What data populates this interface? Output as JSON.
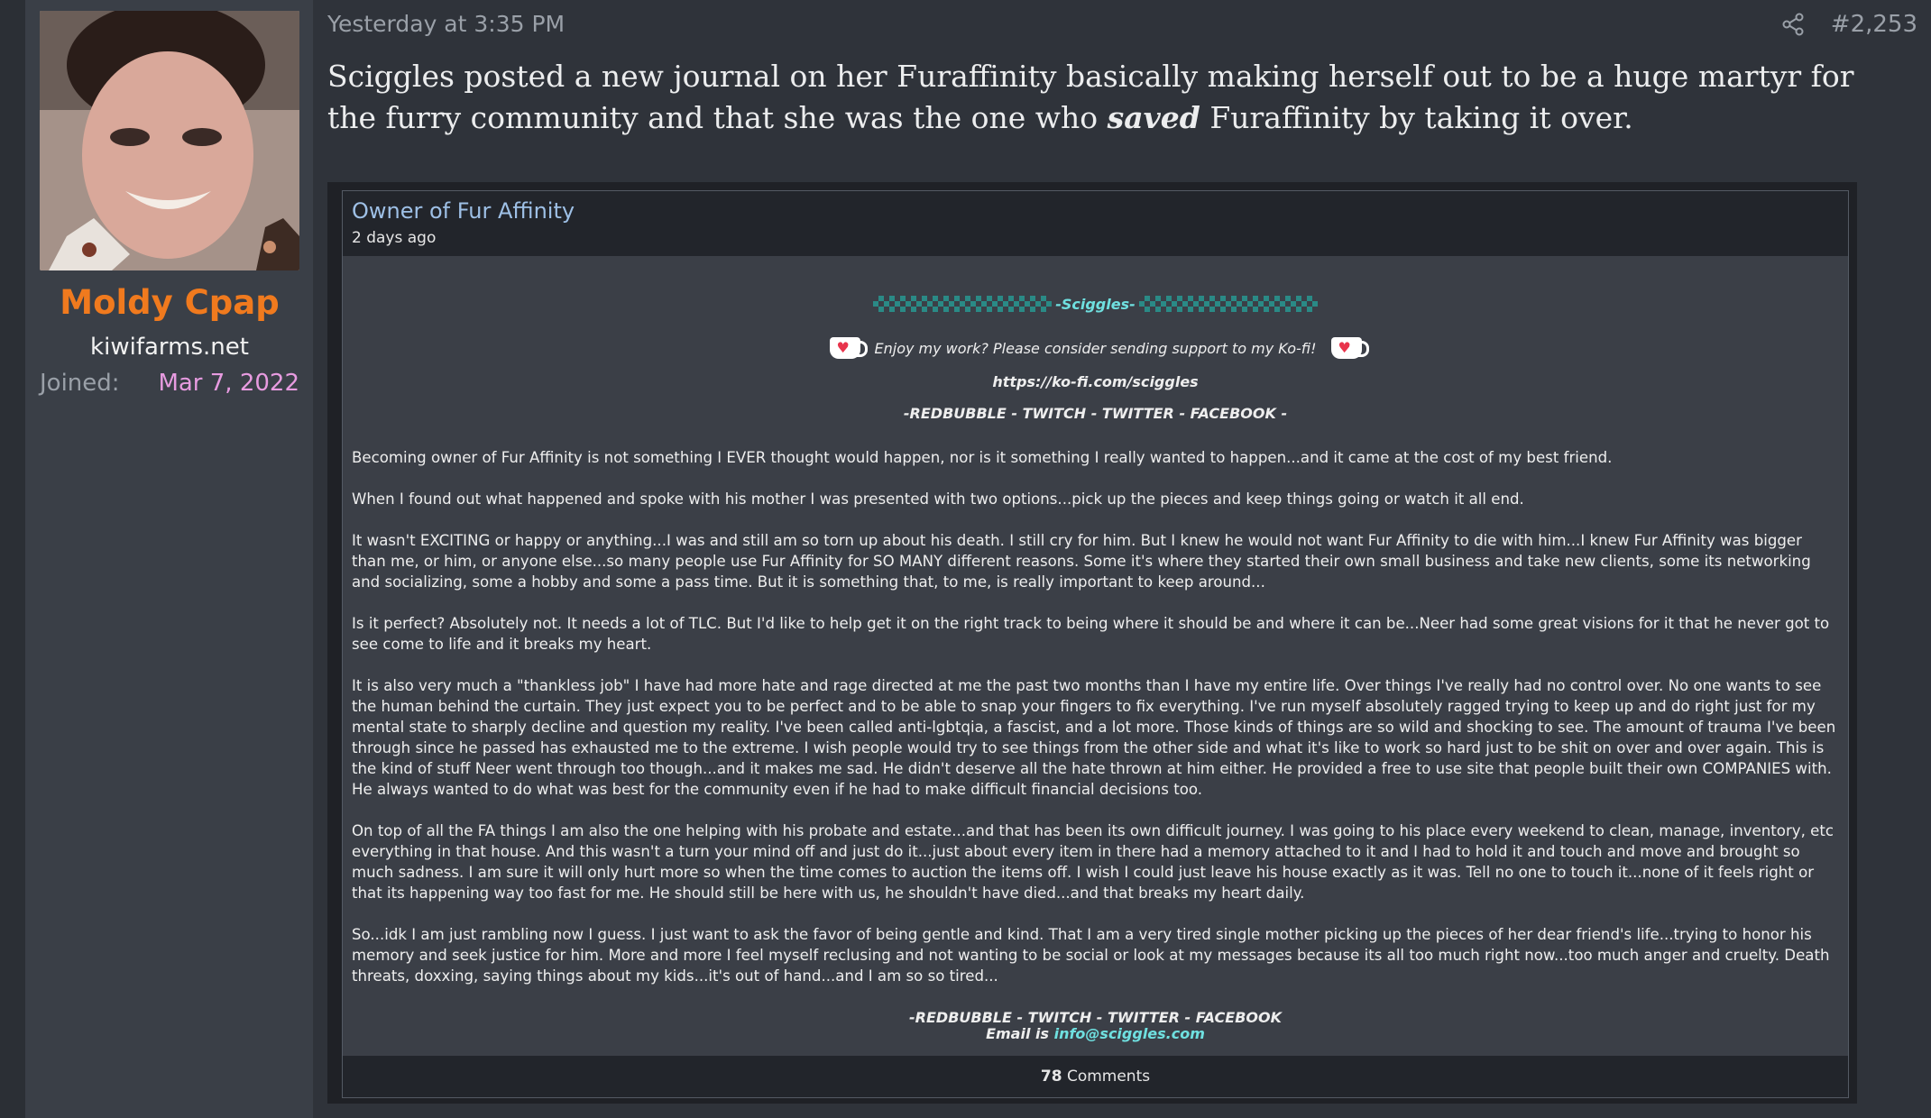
{
  "user": {
    "name": "Moldy Cpap",
    "title": "kiwifarms.net",
    "joined_label": "Joined:",
    "joined_date": "Mar 7, 2022",
    "avatar_icon": "user-avatar-photo"
  },
  "post": {
    "date": "Yesterday at 3:35 PM",
    "number": "#2,253",
    "share_icon": "share-icon",
    "body_before": "Sciggles posted a new journal on her Furaffinity basically making herself out to be a huge martyr for the furry community and that she was the one who ",
    "body_emphasis": "saved",
    "body_after": " Furaffinity by taking it over."
  },
  "journal": {
    "title": "Owner of Fur Affinity",
    "date": "2 days ago",
    "signature_name": "-Sciggles-",
    "kofi_text": "Enjoy my work? Please consider sending support to my Ko-fi!",
    "kofi_url": "https://ko-fi.com/sciggles",
    "links_line": "-REDBUBBLE - TWITCH - TWITTER - FACEBOOK -",
    "paragraphs": [
      "Becoming owner of Fur Affinity is not something I EVER thought would happen, nor is it something I really wanted to happen...and it came at the cost of my best friend.",
      "When I found out what happened and spoke with his mother I was presented with two options...pick up the pieces and keep things going or watch it all end.",
      "It wasn't EXCITING or happy or anything...I was and still am so torn up about his death. I still cry for him. But I knew he would not want Fur Affinity to die with him...I knew Fur Affinity was bigger than me, or him, or anyone else...so many people use Fur Affinity for SO MANY different reasons. Some it's where they started their own small business and take new clients, some its networking and socializing, some a hobby and some a pass time. But it is something that, to me, is really important to keep around...",
      "Is it perfect? Absolutely not. It needs a lot of TLC. But I'd like to help get it on the right track to being where it should be and where it can be...Neer had some great visions for it that he never got to see come to life and it breaks my heart.",
      "It is also very much a \"thankless job\" I have had more hate and rage directed at me the past two months than I have my entire life. Over things I've really had no control over. No one wants to see the human behind the curtain. They just expect you to be perfect and to be able to snap your fingers to fix everything. I've run myself absolutely ragged trying to keep up and do right just for my mental state to sharply decline and question my reality. I've been called anti-lgbtqia, a fascist, and a lot more. Those kinds of things are so wild and shocking to see. The amount of trauma I've been through since he passed has exhausted me to the extreme. I wish people would try to see things from the other side and what it's like to work so hard just to be shit on over and over again. This is the kind of stuff Neer went through too though...and it makes me sad. He didn't deserve all the hate thrown at him either. He provided a free to use site that people built their own COMPANIES with. He always wanted to do what was best for the community even if he had to make difficult financial decisions too.",
      "On top of all the FA things I am also the one helping with his probate and estate...and that has been its own difficult journey. I was going to his place every weekend to clean, manage, inventory, etc everything in that house. And this wasn't a turn your mind off and just do it...just about every item in there had a memory attached to it and I had to hold it and touch and move and brought so much sadness. I am sure it will only hurt more so when the time comes to auction the items off. I wish I could just leave his house exactly as it was. Tell no one to touch it...none of it feels right or that its happening way too fast for me. He should still be here with us, he shouldn't have died...and that breaks my heart daily.",
      "So...idk I am just rambling now I guess. I just want to ask the favor of being gentle and kind. That I am a very tired single mother picking up the pieces of her dear friend's life...trying to honor his memory and seek justice for him. More and more I feel myself reclusing and not wanting to be social or look at my messages because its all too much right now...too much anger and cruelty. Death threats, doxxing, saying things about my kids...it's out of hand...and I am so so tired..."
    ],
    "footer_links": "-REDBUBBLE - TWITCH - TWITTER - FACEBOOK",
    "email_label": "Email is ",
    "email": "info@sciggles.com",
    "comments_count": "78",
    "comments_label": " Comments"
  },
  "colors": {
    "username": "#f07a1e",
    "joined_date": "#e79be0",
    "journal_title": "#9ec0e6",
    "accent_cyan": "#6fe0e0"
  }
}
